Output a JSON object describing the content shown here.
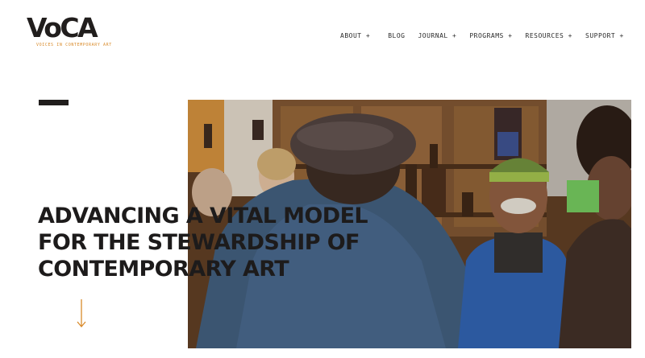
{
  "brand": {
    "logo_text": "VoCA",
    "tagline": "VOICES IN CONTEMPORARY ART"
  },
  "nav": {
    "items": [
      {
        "label": "ABOUT +"
      },
      {
        "label": "BLOG"
      },
      {
        "label": "JOURNAL +"
      },
      {
        "label": "PROGRAMS +"
      },
      {
        "label": "RESOURCES +"
      },
      {
        "label": "SUPPORT +"
      }
    ]
  },
  "hero": {
    "headline_lines": [
      "ADVANCING A VITAL MODEL",
      "FOR THE STEWARDSHIP OF",
      "CONTEMPORARY ART"
    ]
  },
  "colors": {
    "accent": "#d98b2b",
    "text": "#1d1b1b"
  },
  "icons": {
    "scroll": "arrow-down-icon"
  }
}
